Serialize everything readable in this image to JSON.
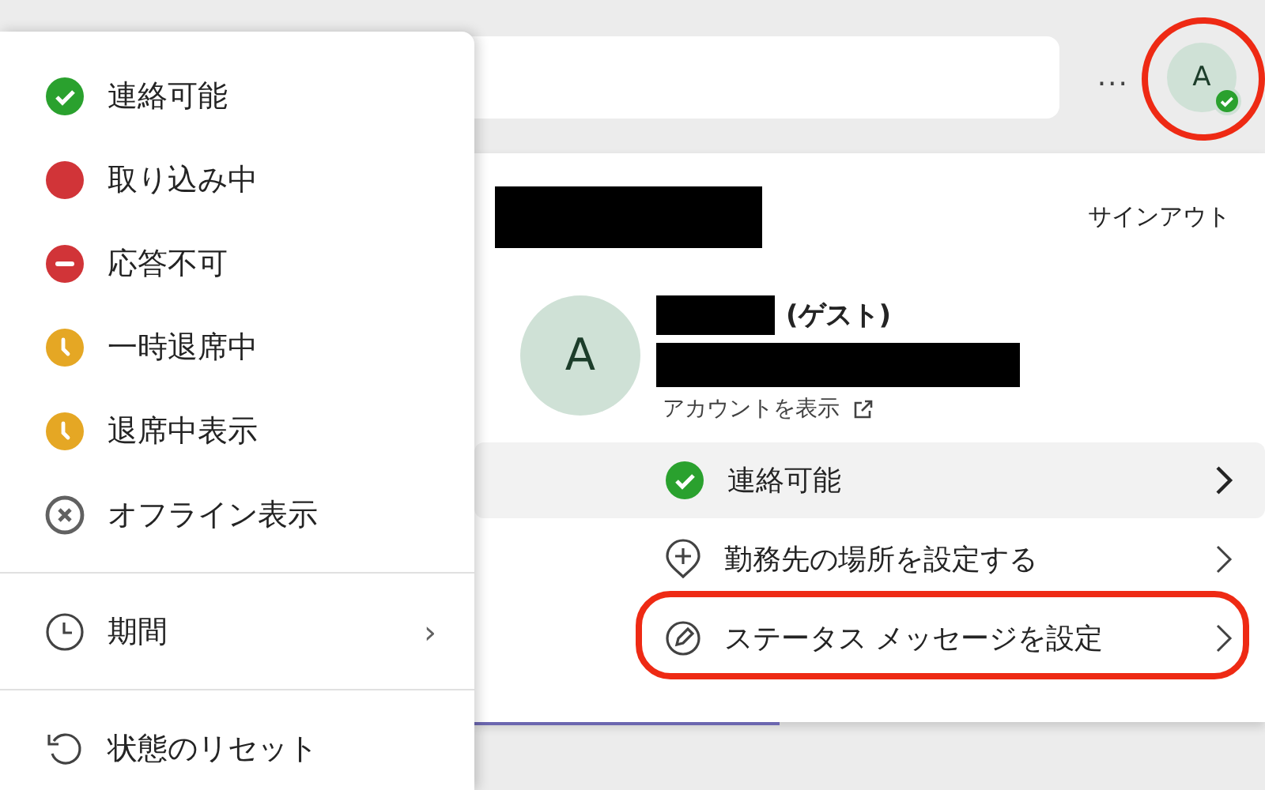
{
  "top_bar": {
    "more_label": "...",
    "avatar": {
      "letter": "A",
      "online": true,
      "annotated": true
    }
  },
  "profile_panel": {
    "sign_out": "サインアウト",
    "avatar_letter": "A",
    "name_suffix": "(ゲスト)",
    "account_link": "アカウントを表示",
    "rows": [
      {
        "kind": "status",
        "label": "連絡可能",
        "highlighted": true,
        "annotated": false
      },
      {
        "kind": "location",
        "label": "勤務先の場所を設定する",
        "highlighted": false,
        "annotated": false
      },
      {
        "kind": "message",
        "label": "ステータス メッセージを設定",
        "highlighted": false,
        "annotated": true
      }
    ]
  },
  "status_menu": {
    "statuses": [
      {
        "kind": "available",
        "label": "連絡可能",
        "color": "#2aa12e"
      },
      {
        "kind": "busy",
        "label": "取り込み中",
        "color": "#d13438"
      },
      {
        "kind": "dnd",
        "label": "応答不可",
        "color": "#d13438"
      },
      {
        "kind": "away",
        "label": "一時退席中",
        "color": "#e5a724"
      },
      {
        "kind": "away",
        "label": "退席中表示",
        "color": "#e5a724"
      },
      {
        "kind": "offline",
        "label": "オフライン表示",
        "color": "#616161"
      }
    ],
    "duration": {
      "label": "期間",
      "chevron": "›"
    },
    "reset": {
      "label": "状態のリセット"
    }
  }
}
